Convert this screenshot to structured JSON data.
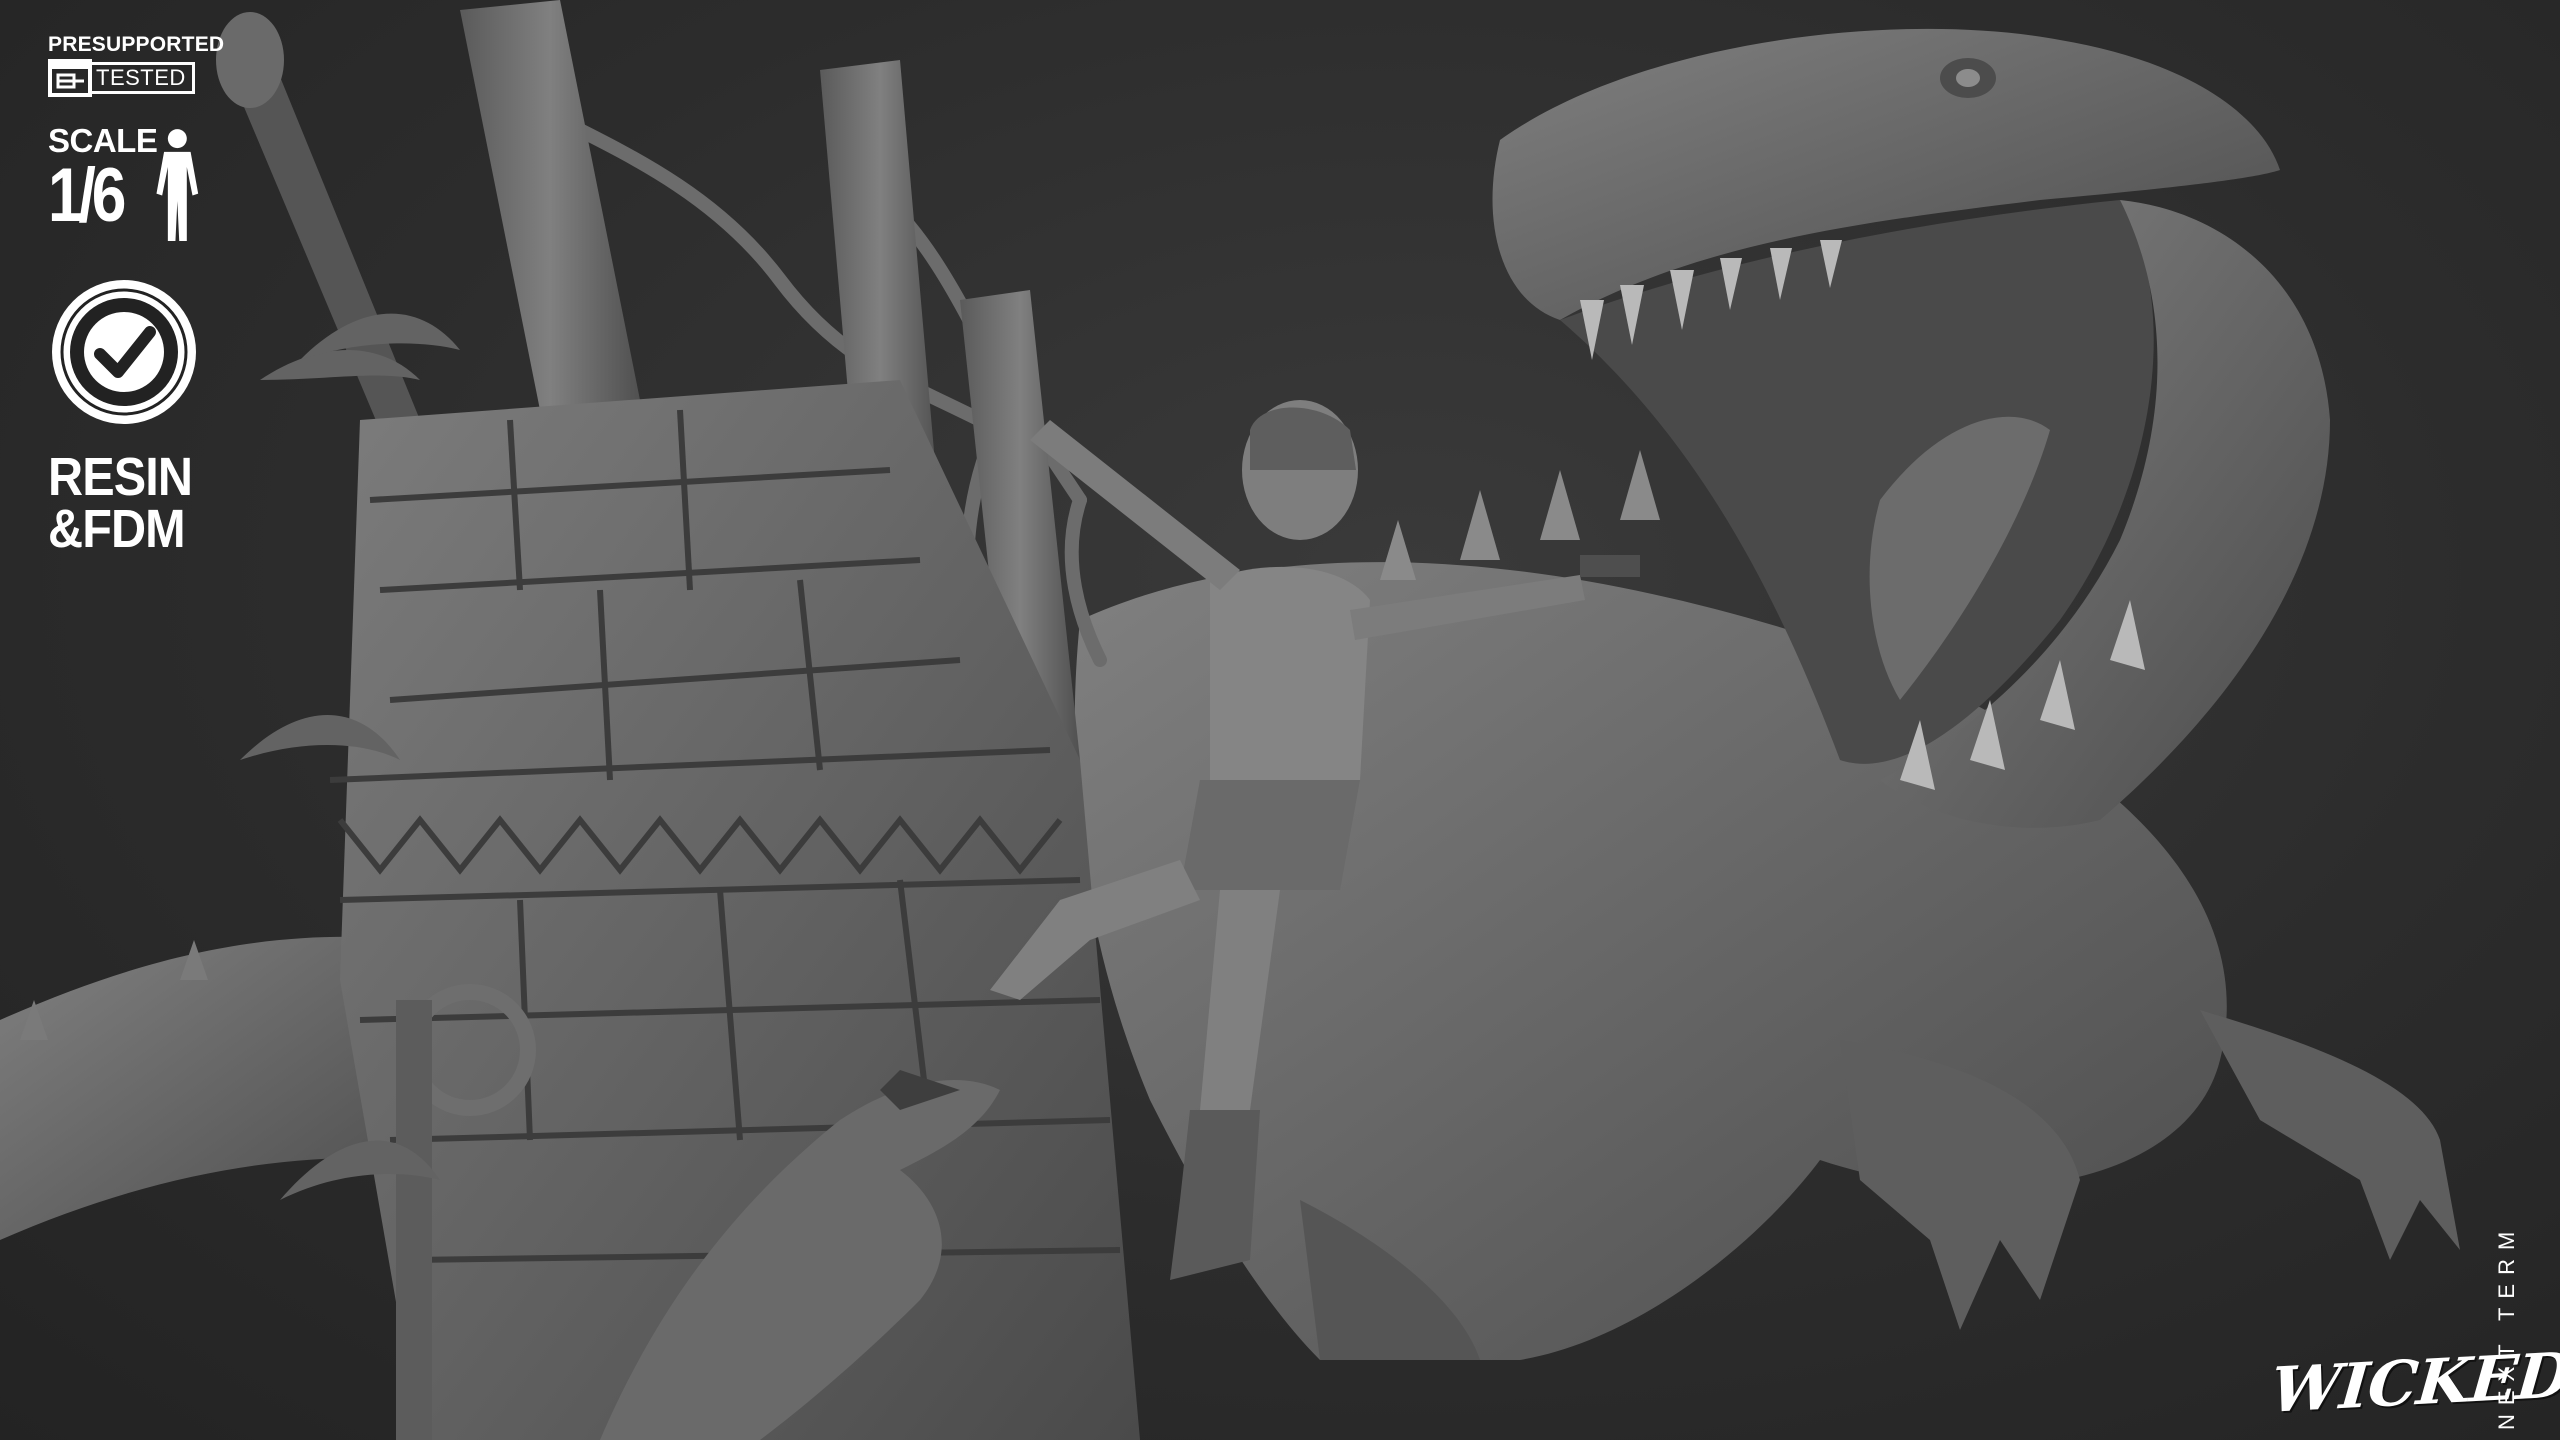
{
  "badges": {
    "presupported_label": "PRESUPPORTED",
    "tested_label": "TESTED",
    "scale_label": "SCALE",
    "scale_value": "1/6",
    "certified_icon": "miniatures-certified-badge-icon",
    "material_line1": "RESIN",
    "material_line2": "&FDM"
  },
  "branding": {
    "logo_text": "WICKED",
    "tagline": "NEXT TERM"
  },
  "colors": {
    "background": "#2b2b2b",
    "sculpt": "#6e6e6e",
    "text": "#ffffff"
  }
}
